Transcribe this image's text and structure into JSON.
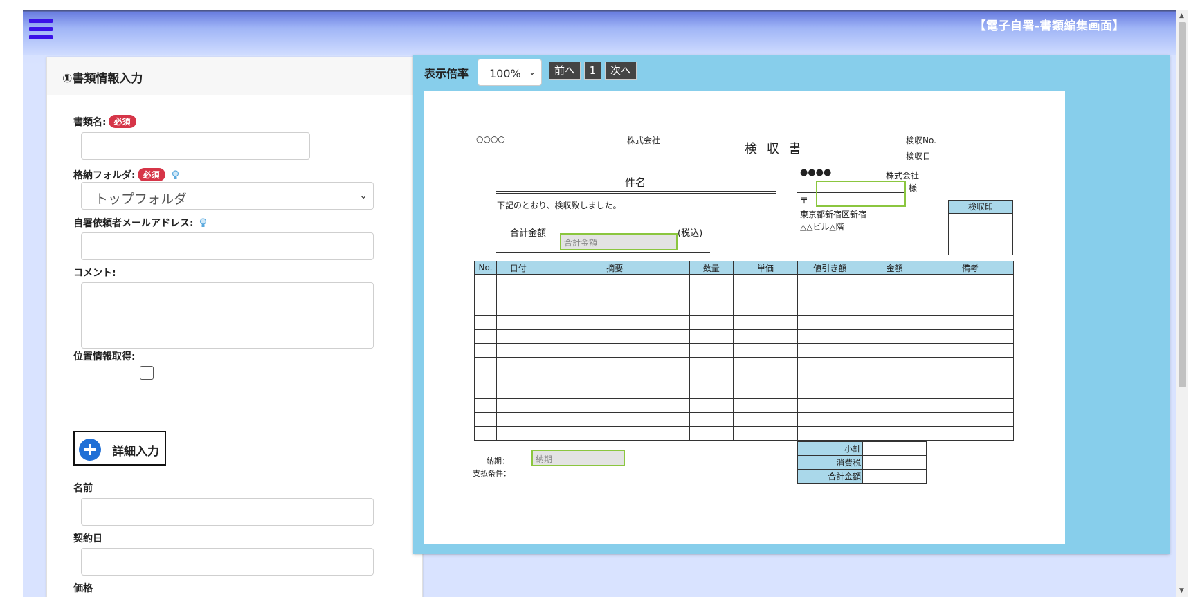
{
  "app": {
    "title": "【電子自署-書類編集画面】"
  },
  "form": {
    "section_title": "①書類情報入力",
    "required_badge": "必須",
    "doc_name_label": "書類名:",
    "folder_label": "格納フォルダ:",
    "folder_value": "トップフォルダ",
    "requester_email_label": "自署依頼者メールアドレス:",
    "comment_label": "コメント:",
    "location_label": "位置情報取得:",
    "detail_button": "詳細入力",
    "name_label": "名前",
    "contract_date_label": "契約日",
    "price_label": "価格"
  },
  "viewer": {
    "zoom_label": "表示倍率",
    "zoom_value": "100%",
    "prev": "前へ",
    "page": "1",
    "next": "次へ"
  },
  "doc": {
    "company_left": "○○○○",
    "company_left_suffix": "株式会社",
    "title": "検 収 書",
    "receipt_no": "検収No.",
    "receipt_date": "検収日",
    "subject": "件名",
    "recipient_dots": "●●●●",
    "recipient_company": "株式会社",
    "honorific": "様",
    "postal_mark": "〒",
    "address1": "東京都新宿区新宿",
    "address2": "△△ビル△階",
    "stamp_header": "検収印",
    "statement": "下記のとおり、検収致しました。",
    "total_label": "合計金額",
    "total_placeholder": "合計金額",
    "tax_incl": "(税込)",
    "columns": [
      "No.",
      "日付",
      "摘要",
      "数量",
      "単価",
      "値引き額",
      "金額",
      "備考"
    ],
    "delivery_label": "納期：",
    "delivery_placeholder": "納期",
    "payment_label": "支払条件：",
    "subtotal": "小計",
    "tax": "消費税",
    "grand_total": "合計金額"
  }
}
